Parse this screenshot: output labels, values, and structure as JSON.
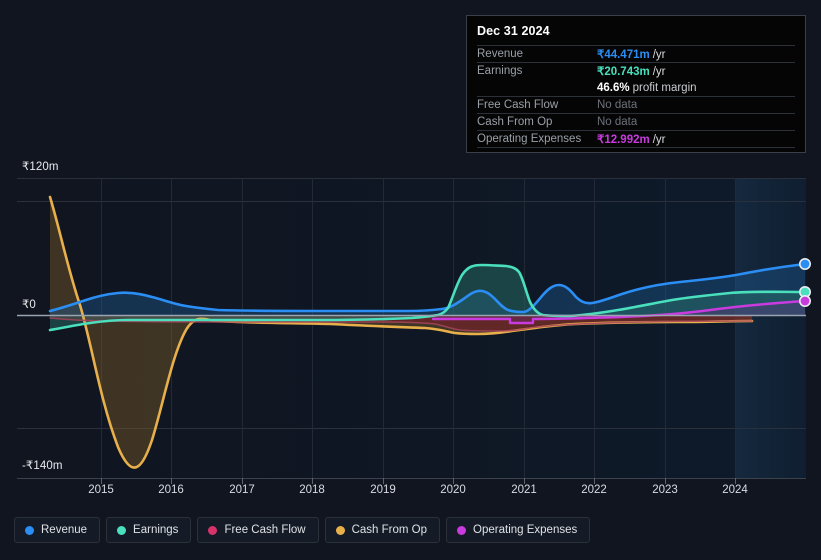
{
  "tooltip": {
    "date": "Dec 31 2024",
    "rows": [
      {
        "key": "Revenue",
        "amount": "₹44.471m",
        "unit": "/yr",
        "color": "#2b8ef4",
        "nodata": null
      },
      {
        "key": "Earnings",
        "amount": "₹20.743m",
        "unit": "/yr",
        "color": "#4ae0bd",
        "nodata": null
      },
      {
        "key": "",
        "margin_num": "46.6%",
        "margin_text": "profit margin"
      },
      {
        "key": "Free Cash Flow",
        "nodata": "No data"
      },
      {
        "key": "Cash From Op",
        "nodata": "No data"
      },
      {
        "key": "Operating Expenses",
        "amount": "₹12.992m",
        "unit": "/yr",
        "color": "#c93bdf",
        "nodata": null
      }
    ]
  },
  "axes": {
    "y_top": "₹120m",
    "y_zero": "₹0",
    "y_bottom": "-₹140m",
    "x_ticks": [
      "2015",
      "2016",
      "2017",
      "2018",
      "2019",
      "2020",
      "2021",
      "2022",
      "2023",
      "2024"
    ]
  },
  "legend": [
    {
      "label": "Revenue",
      "color": "#2b8ef4"
    },
    {
      "label": "Earnings",
      "color": "#4ae0bd"
    },
    {
      "label": "Free Cash Flow",
      "color": "#d6336c"
    },
    {
      "label": "Cash From Op",
      "color": "#e8b04b"
    },
    {
      "label": "Operating Expenses",
      "color": "#c93bdf"
    }
  ],
  "chart_data": {
    "type": "area",
    "title": "",
    "xlabel": "",
    "ylabel": "",
    "currency": "₹",
    "unit": "m",
    "ylim": [
      -140,
      120
    ],
    "y_ticks": [
      120,
      0,
      -140
    ],
    "grid": true,
    "legend_position": "bottom",
    "x_range": [
      2014.75,
      2025.0
    ],
    "x": [
      2014.78,
      2015.0,
      2015.2,
      2015.4,
      2015.6,
      2015.8,
      2016.0,
      2016.3,
      2016.7,
      2017.0,
      2017.5,
      2018.0,
      2018.5,
      2019.0,
      2019.4,
      2019.7,
      2019.9,
      2020.1,
      2020.3,
      2020.5,
      2020.7,
      2020.9,
      2021.0,
      2021.2,
      2021.4,
      2021.6,
      2021.9,
      2022.2,
      2022.6,
      2023.0,
      2023.5,
      2024.0,
      2024.5,
      2024.97
    ],
    "series": [
      {
        "name": "Revenue",
        "color": "#2b8ef4",
        "fill": "rgba(33,110,180,0.30)",
        "values": [
          6,
          9,
          13,
          17,
          20,
          22,
          23,
          22,
          19,
          16,
          13,
          12,
          11,
          11,
          10,
          10,
          10,
          11,
          15,
          19,
          13,
          11,
          21,
          24,
          17,
          14,
          16,
          22,
          26,
          28,
          30,
          33,
          38,
          44.471
        ],
        "end_marker": true
      },
      {
        "name": "Earnings",
        "color": "#4ae0bd",
        "fill": "rgba(42,120,112,0.35)",
        "values": [
          -10,
          -8,
          -6,
          -5,
          -4,
          -3.5,
          -3,
          -3,
          -3,
          -3,
          -2.5,
          -2,
          -2,
          -2,
          -2,
          -1,
          1,
          18,
          36,
          42,
          43,
          40,
          30,
          10,
          3,
          3,
          4,
          7,
          10,
          12,
          14,
          16,
          18,
          20.743
        ],
        "end_marker": true
      },
      {
        "name": "Free Cash Flow",
        "color": "#d6336c",
        "fill": "rgba(120,34,40,0.55)",
        "values": [
          -3,
          -4,
          -5,
          -5,
          -5,
          -5,
          -5,
          -5,
          -5,
          -5,
          -5,
          -5,
          -5,
          -5,
          -6,
          -7,
          -8,
          -9,
          -10,
          -10,
          -9,
          -8,
          -8,
          -7,
          -6,
          -6,
          -6,
          -5,
          -5,
          -5,
          -5,
          -5,
          -5,
          null
        ],
        "end_marker": false,
        "no_data_latest": true
      },
      {
        "name": "Cash From Op",
        "color": "#e8b04b",
        "fill": "rgba(120,90,40,0.40)",
        "values": [
          132,
          60,
          -40,
          -110,
          -138,
          -120,
          -60,
          -14,
          -7,
          -6,
          -6,
          -6,
          -6,
          -7,
          -8,
          -10,
          -12,
          -13,
          -14,
          -14,
          -13,
          -12,
          -11,
          -9,
          -8,
          -8,
          -8,
          -7,
          -7,
          -7,
          -7,
          -7,
          -7,
          null
        ],
        "end_marker": false,
        "no_data_latest": true
      },
      {
        "name": "Operating Expenses",
        "color": "#c93bdf",
        "fill": "rgba(110,45,130,0.30)",
        "values": [
          null,
          null,
          null,
          null,
          null,
          null,
          null,
          null,
          null,
          null,
          null,
          null,
          null,
          null,
          -4,
          -4,
          -4,
          -4,
          -4,
          -4,
          -4,
          -6,
          -4,
          -4,
          -4,
          -4,
          -4,
          -4,
          -3,
          -2,
          1,
          5,
          9,
          12.992
        ],
        "end_marker": true
      }
    ],
    "forecast_band": {
      "start_x": 2023.85,
      "end_x": 2025.0,
      "label": ""
    }
  }
}
